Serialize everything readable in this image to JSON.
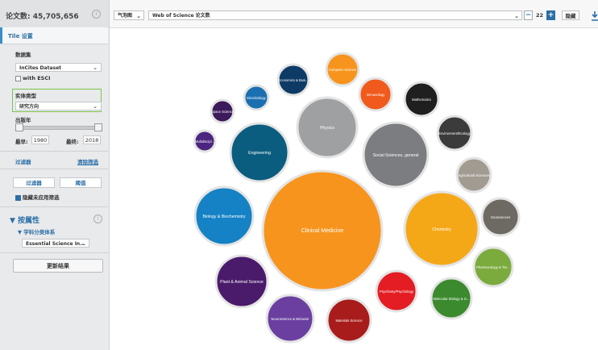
{
  "sidebar": {
    "count_label": "论文数: 45,705,656",
    "info_icon": "info-circle-icon",
    "tile_tab": "Tile 设置",
    "dataset_label": "数据集",
    "dataset_value": "InCites Dataset",
    "esci_label": "with ESCI",
    "entity_label": "实体类型",
    "entity_value": "研究方向",
    "year_label": "出版年",
    "min_label": "最早:",
    "min_value": "1980",
    "max_label": "最终:",
    "max_value": "2018",
    "filter_label": "过滤器",
    "clear_filter": "清除筛选",
    "filter_tab": "过滤器",
    "threshold_tab": "阈值",
    "hide_unapplied": "隐藏未应用筛选",
    "attr_title": "▼ 按属性",
    "subject_scheme": "▼ 学科分类体系",
    "scheme_value": "Essential Science In...",
    "update_button": "更新结果"
  },
  "topbar": {
    "viz_type": "气泡图",
    "metric": "Web of Science 论文数",
    "minus": "−",
    "count": "22",
    "plus": "+",
    "hide": "隐藏",
    "download_icon": "download-icon"
  },
  "chart_data": {
    "type": "bubble",
    "bubbles": [
      {
        "label": "Clinical Medicine",
        "color": "#f7941d",
        "value": 100
      },
      {
        "label": "Chemistry",
        "color": "#f5a817",
        "value": 47
      },
      {
        "label": "Social Sciences, general",
        "color": "#7b7d80",
        "value": 38
      },
      {
        "label": "Physics",
        "color": "#9fa0a2",
        "value": 33
      },
      {
        "label": "Engineering",
        "color": "#0b5d7f",
        "value": 32
      },
      {
        "label": "Biology & Biochemistry",
        "color": "#1482c4",
        "value": 29
      },
      {
        "label": "Plant & Animal Science",
        "color": "#4a1a6b",
        "value": 24
      },
      {
        "label": "Neuroscience & Behavior",
        "color": "#6a3fa0",
        "value": 19
      },
      {
        "label": "Materials Science",
        "color": "#a81c1c",
        "value": 18
      },
      {
        "label": "Psychiatry/Psychology",
        "color": "#e31d23",
        "value": 15
      },
      {
        "label": "Molecular Biology & G...",
        "color": "#3b8a2e",
        "value": 14
      },
      {
        "label": "Pharmacology & Tox...",
        "color": "#7bab3c",
        "value": 12
      },
      {
        "label": "Geosciences",
        "color": "#6d6963",
        "value": 11
      },
      {
        "label": "Agricultural Sciences",
        "color": "#a29b92",
        "value": 10
      },
      {
        "label": "Environment/Ecology",
        "color": "#3b3b3b",
        "value": 10
      },
      {
        "label": "Mathematics",
        "color": "#1f1f1f",
        "value": 10
      },
      {
        "label": "Immunology",
        "color": "#f05a1c",
        "value": 10
      },
      {
        "label": "Computer Science",
        "color": "#f7941d",
        "value": 9
      },
      {
        "label": "Economics & Busi...",
        "color": "#0d3b66",
        "value": 8
      },
      {
        "label": "Microbiology",
        "color": "#1a6fb0",
        "value": 6
      },
      {
        "label": "Space Science",
        "color": "#3d1a5b",
        "value": 4
      },
      {
        "label": "Multidiscipl...",
        "color": "#4b2580",
        "value": 4
      }
    ]
  }
}
